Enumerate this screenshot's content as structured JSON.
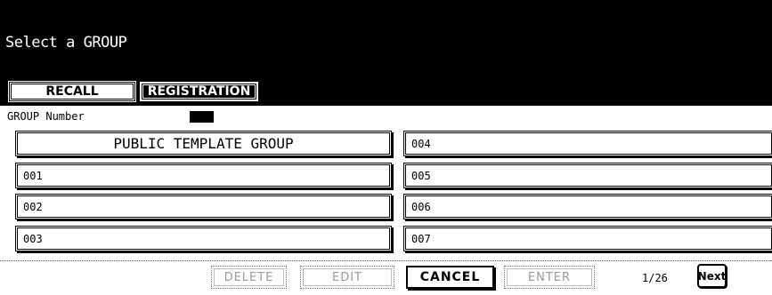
{
  "header": {
    "title": "Select a GROUP"
  },
  "tabs": {
    "recall": "RECALL",
    "registration": "REGISTRATION"
  },
  "group_number": {
    "label": "GROUP Number"
  },
  "groups": {
    "left": [
      "PUBLIC TEMPLATE GROUP",
      "001",
      "002",
      "003"
    ],
    "right": [
      "004",
      "005",
      "006",
      "007"
    ]
  },
  "controls": {
    "delete": "DELETE",
    "edit": "EDIT",
    "cancel": "CANCEL",
    "enter": "ENTER",
    "page": "1/26",
    "next": "Next"
  }
}
